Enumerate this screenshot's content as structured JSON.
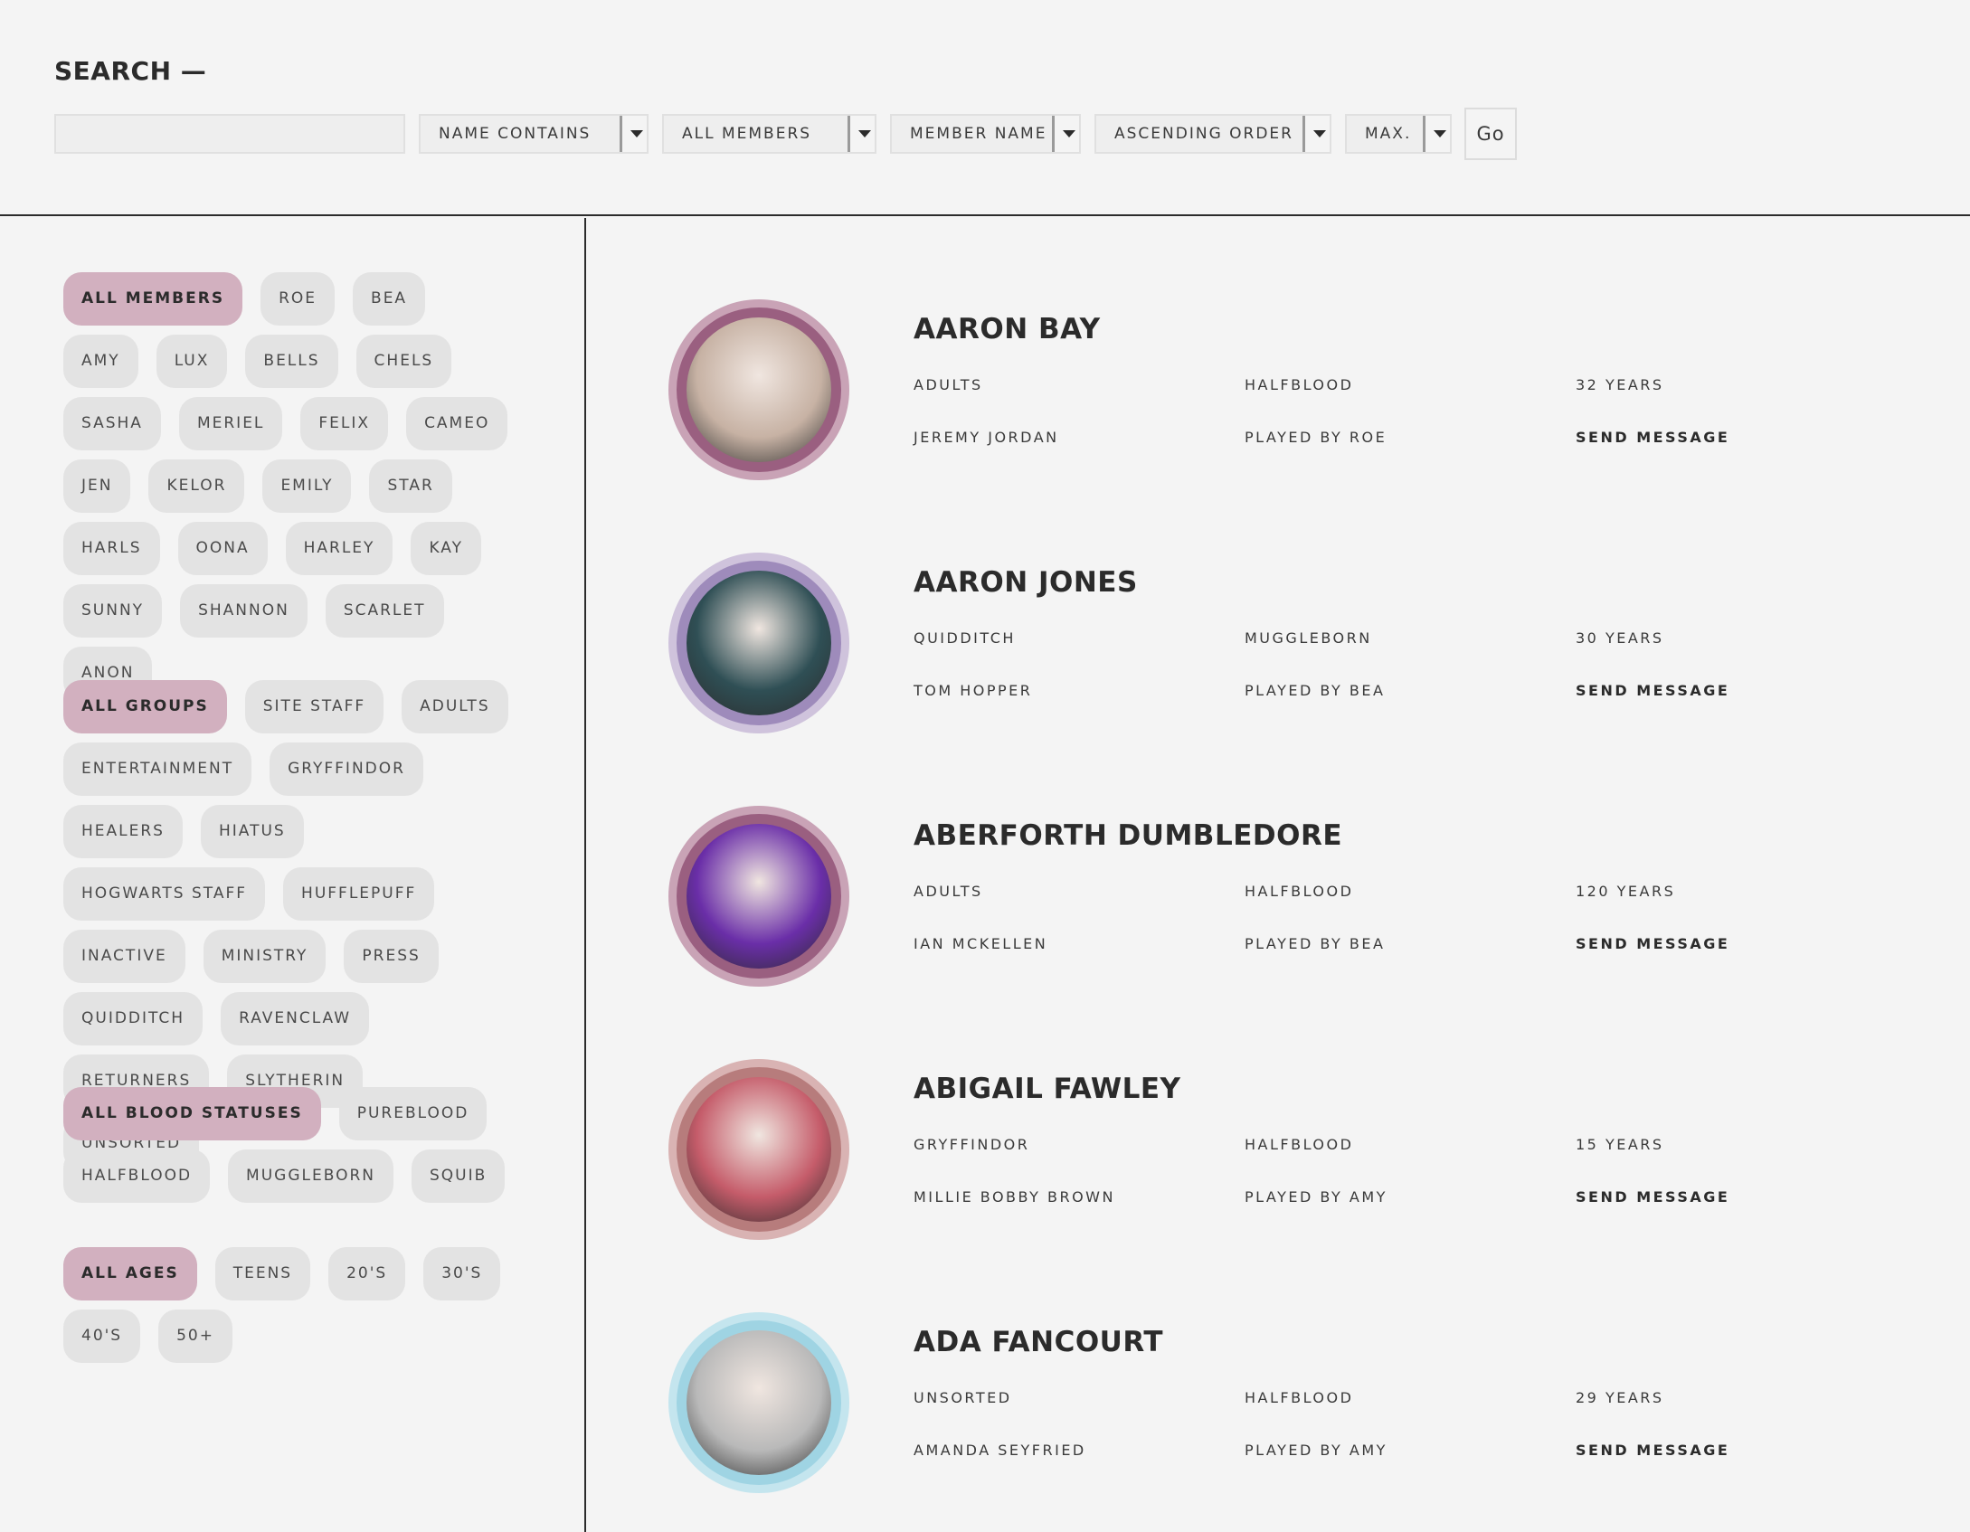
{
  "search": {
    "title": "SEARCH —",
    "input_value": "",
    "filters": [
      "NAME CONTAINS",
      "ALL MEMBERS",
      "MEMBER NAME",
      "ASCENDING ORDER",
      "MAX."
    ],
    "go_label": "Go"
  },
  "sidebar": {
    "players": [
      "ALL MEMBERS",
      "ROE",
      "BEA",
      "AMY",
      "LUX",
      "BELLS",
      "CHELS",
      "SASHA",
      "MERIEL",
      "FELIX",
      "CAMEO",
      "JEN",
      "KELOR",
      "EMILY",
      "STAR",
      "HARLS",
      "OONA",
      "HARLEY",
      "KAY",
      "SUNNY",
      "SHANNON",
      "SCARLET",
      "ANON"
    ],
    "groups": [
      "ALL GROUPS",
      "SITE STAFF",
      "ADULTS",
      "ENTERTAINMENT",
      "GRYFFINDOR",
      "HEALERS",
      "HIATUS",
      "HOGWARTS STAFF",
      "HUFFLEPUFF",
      "INACTIVE",
      "MINISTRY",
      "PRESS",
      "QUIDDITCH",
      "RAVENCLAW",
      "RETURNERS",
      "SLYTHERIN",
      "UNSORTED"
    ],
    "blood_statuses": [
      "ALL BLOOD STATUSES",
      "PUREBLOOD",
      "HALFBLOOD",
      "MUGGLEBORN",
      "SQUIB"
    ],
    "ages": [
      "ALL AGES",
      "TEENS",
      "20'S",
      "30'S",
      "40'S",
      "50+"
    ]
  },
  "members": [
    {
      "name": "AARON BAY",
      "group": "ADULTS",
      "blood": "HALFBLOOD",
      "age": "32 YEARS",
      "faceclaim": "JEREMY JORDAN",
      "played_by": "PLAYED BY ROE",
      "action": "SEND MESSAGE",
      "ring_color": "#c9a3b6",
      "inner_color": "#9a5f80",
      "photo_color": "#c7b2a4"
    },
    {
      "name": "AARON JONES",
      "group": "QUIDDITCH",
      "blood": "MUGGLEBORN",
      "age": "30 YEARS",
      "faceclaim": "TOM HOPPER",
      "played_by": "PLAYED BY BEA",
      "action": "SEND MESSAGE",
      "ring_color": "#cfc3dc",
      "inner_color": "#9e8bbb",
      "photo_color": "#2f4f55"
    },
    {
      "name": "ABERFORTH DUMBLEDORE",
      "group": "ADULTS",
      "blood": "HALFBLOOD",
      "age": "120 YEARS",
      "faceclaim": "IAN MCKELLEN",
      "played_by": "PLAYED BY BEA",
      "action": "SEND MESSAGE",
      "ring_color": "#c9a3b6",
      "inner_color": "#9a5f80",
      "photo_color": "#6a2ea8"
    },
    {
      "name": "ABIGAIL FAWLEY",
      "group": "GRYFFINDOR",
      "blood": "HALFBLOOD",
      "age": "15 YEARS",
      "faceclaim": "MILLIE BOBBY BROWN",
      "played_by": "PLAYED BY AMY",
      "action": "SEND MESSAGE",
      "ring_color": "#d9b3b3",
      "inner_color": "#b77c7c",
      "photo_color": "#c55c6a"
    },
    {
      "name": "ADA FANCOURT",
      "group": "UNSORTED",
      "blood": "HALFBLOOD",
      "age": "29 YEARS",
      "faceclaim": "AMANDA SEYFRIED",
      "played_by": "PLAYED BY AMY",
      "action": "SEND MESSAGE",
      "ring_color": "#c4e5ee",
      "inner_color": "#9fd4e3",
      "photo_color": "#b9b9b9"
    }
  ]
}
